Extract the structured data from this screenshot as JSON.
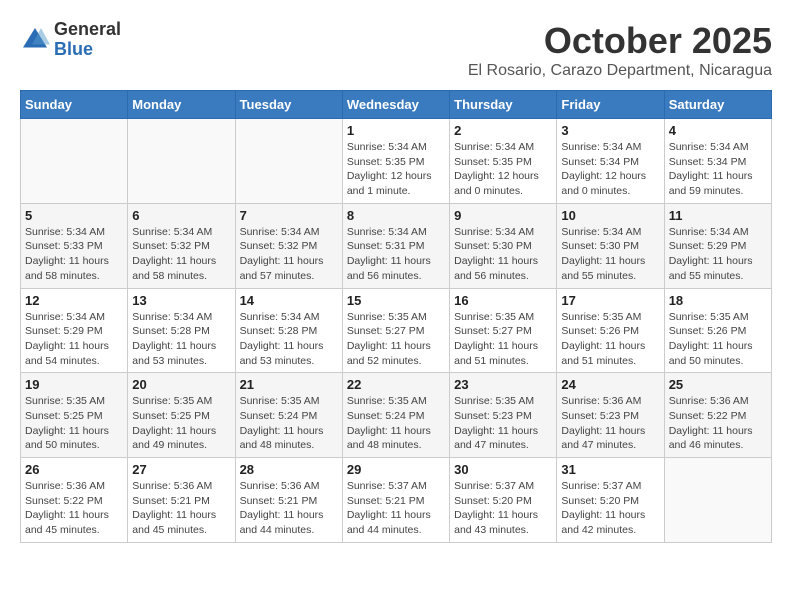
{
  "header": {
    "logo_general": "General",
    "logo_blue": "Blue",
    "title": "October 2025",
    "subtitle": "El Rosario, Carazo Department, Nicaragua"
  },
  "calendar": {
    "days_of_week": [
      "Sunday",
      "Monday",
      "Tuesday",
      "Wednesday",
      "Thursday",
      "Friday",
      "Saturday"
    ],
    "weeks": [
      [
        {
          "day": "",
          "info": ""
        },
        {
          "day": "",
          "info": ""
        },
        {
          "day": "",
          "info": ""
        },
        {
          "day": "1",
          "info": "Sunrise: 5:34 AM\nSunset: 5:35 PM\nDaylight: 12 hours and 1 minute."
        },
        {
          "day": "2",
          "info": "Sunrise: 5:34 AM\nSunset: 5:35 PM\nDaylight: 12 hours and 0 minutes."
        },
        {
          "day": "3",
          "info": "Sunrise: 5:34 AM\nSunset: 5:34 PM\nDaylight: 12 hours and 0 minutes."
        },
        {
          "day": "4",
          "info": "Sunrise: 5:34 AM\nSunset: 5:34 PM\nDaylight: 11 hours and 59 minutes."
        }
      ],
      [
        {
          "day": "5",
          "info": "Sunrise: 5:34 AM\nSunset: 5:33 PM\nDaylight: 11 hours and 58 minutes."
        },
        {
          "day": "6",
          "info": "Sunrise: 5:34 AM\nSunset: 5:32 PM\nDaylight: 11 hours and 58 minutes."
        },
        {
          "day": "7",
          "info": "Sunrise: 5:34 AM\nSunset: 5:32 PM\nDaylight: 11 hours and 57 minutes."
        },
        {
          "day": "8",
          "info": "Sunrise: 5:34 AM\nSunset: 5:31 PM\nDaylight: 11 hours and 56 minutes."
        },
        {
          "day": "9",
          "info": "Sunrise: 5:34 AM\nSunset: 5:30 PM\nDaylight: 11 hours and 56 minutes."
        },
        {
          "day": "10",
          "info": "Sunrise: 5:34 AM\nSunset: 5:30 PM\nDaylight: 11 hours and 55 minutes."
        },
        {
          "day": "11",
          "info": "Sunrise: 5:34 AM\nSunset: 5:29 PM\nDaylight: 11 hours and 55 minutes."
        }
      ],
      [
        {
          "day": "12",
          "info": "Sunrise: 5:34 AM\nSunset: 5:29 PM\nDaylight: 11 hours and 54 minutes."
        },
        {
          "day": "13",
          "info": "Sunrise: 5:34 AM\nSunset: 5:28 PM\nDaylight: 11 hours and 53 minutes."
        },
        {
          "day": "14",
          "info": "Sunrise: 5:34 AM\nSunset: 5:28 PM\nDaylight: 11 hours and 53 minutes."
        },
        {
          "day": "15",
          "info": "Sunrise: 5:35 AM\nSunset: 5:27 PM\nDaylight: 11 hours and 52 minutes."
        },
        {
          "day": "16",
          "info": "Sunrise: 5:35 AM\nSunset: 5:27 PM\nDaylight: 11 hours and 51 minutes."
        },
        {
          "day": "17",
          "info": "Sunrise: 5:35 AM\nSunset: 5:26 PM\nDaylight: 11 hours and 51 minutes."
        },
        {
          "day": "18",
          "info": "Sunrise: 5:35 AM\nSunset: 5:26 PM\nDaylight: 11 hours and 50 minutes."
        }
      ],
      [
        {
          "day": "19",
          "info": "Sunrise: 5:35 AM\nSunset: 5:25 PM\nDaylight: 11 hours and 50 minutes."
        },
        {
          "day": "20",
          "info": "Sunrise: 5:35 AM\nSunset: 5:25 PM\nDaylight: 11 hours and 49 minutes."
        },
        {
          "day": "21",
          "info": "Sunrise: 5:35 AM\nSunset: 5:24 PM\nDaylight: 11 hours and 48 minutes."
        },
        {
          "day": "22",
          "info": "Sunrise: 5:35 AM\nSunset: 5:24 PM\nDaylight: 11 hours and 48 minutes."
        },
        {
          "day": "23",
          "info": "Sunrise: 5:35 AM\nSunset: 5:23 PM\nDaylight: 11 hours and 47 minutes."
        },
        {
          "day": "24",
          "info": "Sunrise: 5:36 AM\nSunset: 5:23 PM\nDaylight: 11 hours and 47 minutes."
        },
        {
          "day": "25",
          "info": "Sunrise: 5:36 AM\nSunset: 5:22 PM\nDaylight: 11 hours and 46 minutes."
        }
      ],
      [
        {
          "day": "26",
          "info": "Sunrise: 5:36 AM\nSunset: 5:22 PM\nDaylight: 11 hours and 45 minutes."
        },
        {
          "day": "27",
          "info": "Sunrise: 5:36 AM\nSunset: 5:21 PM\nDaylight: 11 hours and 45 minutes."
        },
        {
          "day": "28",
          "info": "Sunrise: 5:36 AM\nSunset: 5:21 PM\nDaylight: 11 hours and 44 minutes."
        },
        {
          "day": "29",
          "info": "Sunrise: 5:37 AM\nSunset: 5:21 PM\nDaylight: 11 hours and 44 minutes."
        },
        {
          "day": "30",
          "info": "Sunrise: 5:37 AM\nSunset: 5:20 PM\nDaylight: 11 hours and 43 minutes."
        },
        {
          "day": "31",
          "info": "Sunrise: 5:37 AM\nSunset: 5:20 PM\nDaylight: 11 hours and 42 minutes."
        },
        {
          "day": "",
          "info": ""
        }
      ]
    ]
  }
}
